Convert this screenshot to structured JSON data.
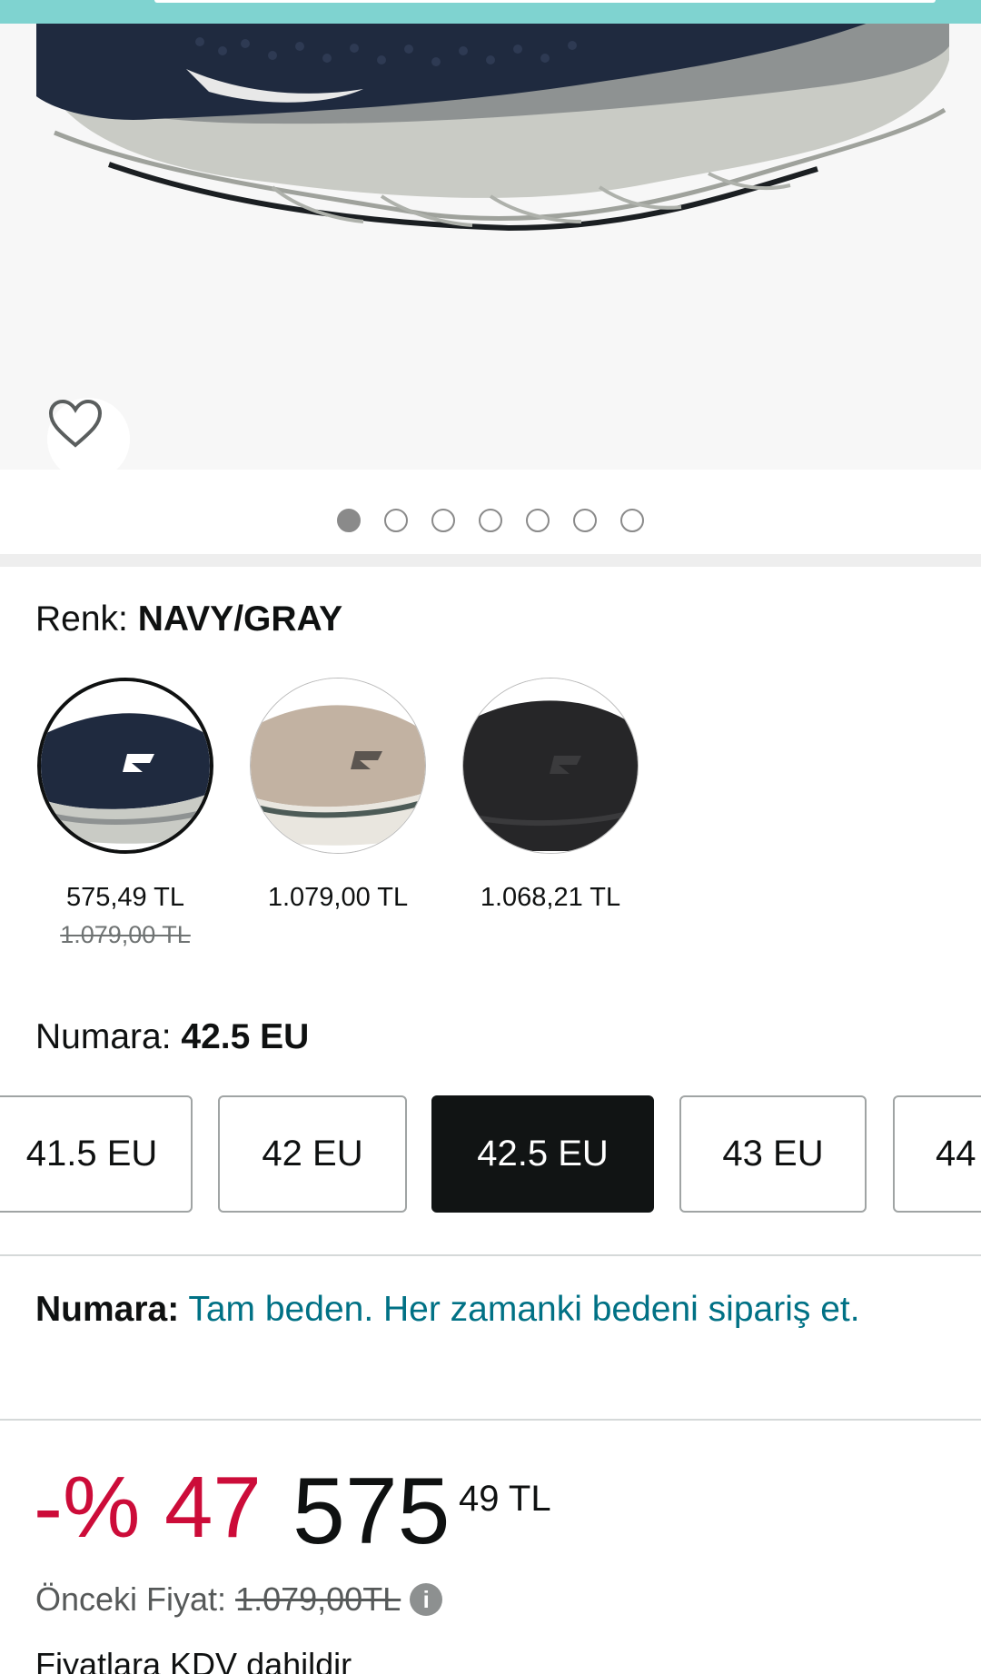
{
  "product_gallery": {
    "image_alt": "Navy/Gray running shoe",
    "dots_count": 7,
    "active_dot": 1
  },
  "color": {
    "label": "Renk:",
    "selected_value": "NAVY/GRAY",
    "swatches": [
      {
        "price": "575,49 TL",
        "old_price": "1.079,00 TL",
        "selected": true
      },
      {
        "price": "1.079,00 TL",
        "old_price": "",
        "selected": false
      },
      {
        "price": "1.068,21 TL",
        "old_price": "",
        "selected": false
      }
    ]
  },
  "size": {
    "label": "Numara:",
    "selected_value": "42.5 EU",
    "options": [
      "41.5 EU",
      "42 EU",
      "42.5 EU",
      "43 EU",
      "44"
    ]
  },
  "fit": {
    "label": "Numara:",
    "text": "Tam beden. Her zamanki bedeni sipariş et."
  },
  "pricing": {
    "discount": "-% 47",
    "price_whole": "575",
    "price_fraction": "49",
    "currency": "TL",
    "previous_label": "Önceki Fiyat:",
    "previous_price": "1.079,00TL",
    "vat_text": "Fiyatlara KDV dahildir"
  },
  "colors": {
    "link": "#007185",
    "discount": "#cc0c39",
    "selected_size_bg": "#111414",
    "top_strip": "#7fd3d0"
  },
  "icons": {
    "wishlist": "heart-outline-icon",
    "info": "info-icon"
  }
}
